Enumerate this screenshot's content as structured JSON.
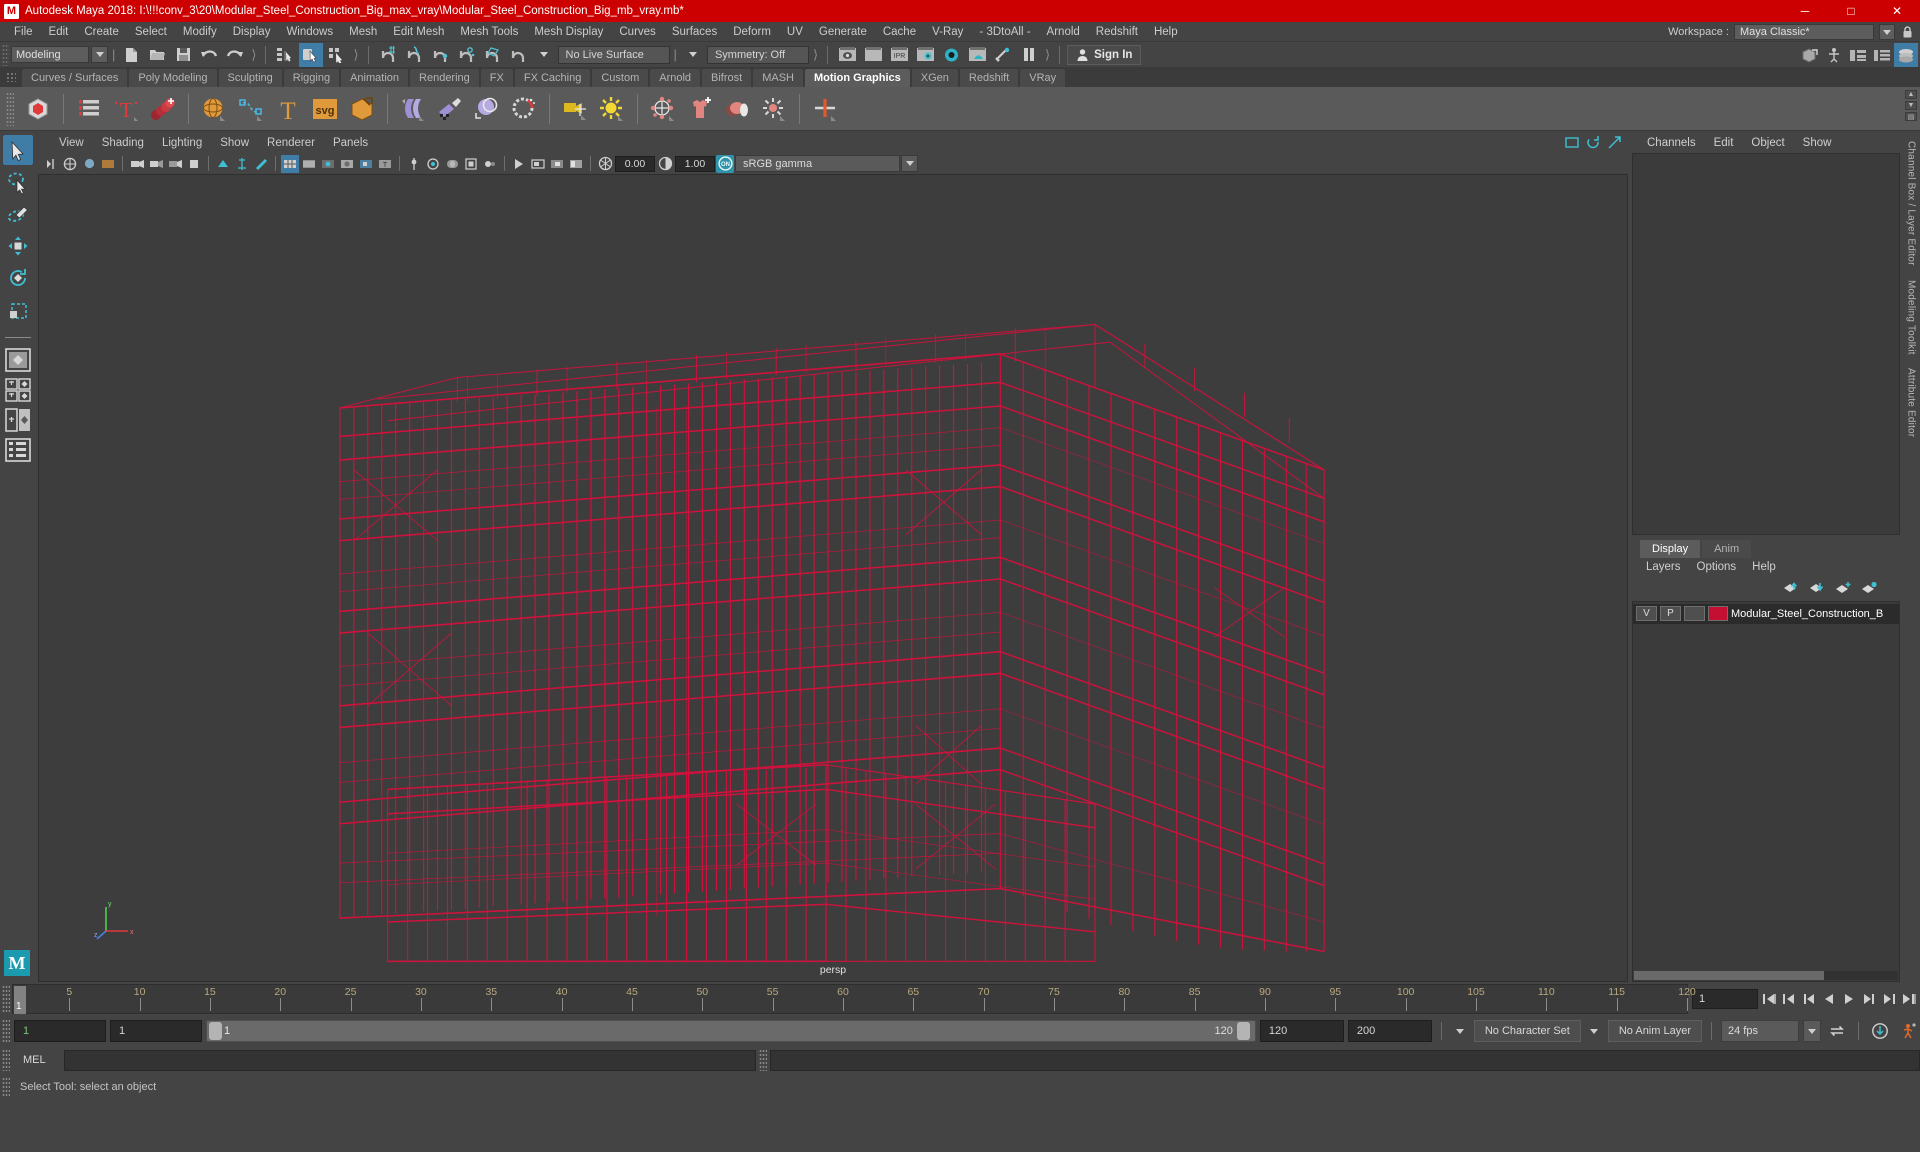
{
  "window": {
    "title": "Autodesk Maya 2018: I:\\!!!conv_3\\20\\Modular_Steel_Construction_Big_max_vray\\Modular_Steel_Construction_Big_mb_vray.mb*",
    "app_initial": "M",
    "titlebar_color": "#cc0000",
    "controls": {
      "minimize": "─",
      "maximize": "□",
      "close": "✕"
    }
  },
  "menubar": {
    "items": [
      "File",
      "Edit",
      "Create",
      "Select",
      "Modify",
      "Display",
      "Windows",
      "Mesh",
      "Edit Mesh",
      "Mesh Tools",
      "Mesh Display",
      "Curves",
      "Surfaces",
      "Deform",
      "UV",
      "Generate",
      "Cache",
      "V-Ray",
      "- 3DtoAll -",
      "Arnold",
      "Redshift",
      "Help"
    ],
    "workspace_label": "Workspace :",
    "workspace_value": "Maya Classic*"
  },
  "statusline": {
    "mode_menu": "Modeling",
    "live_surface": "No Live Surface",
    "symmetry": "Symmetry: Off",
    "signin": "Sign In",
    "icons": [
      "new-scene-icon",
      "open-scene-icon",
      "save-scene-icon",
      "undo-icon",
      "redo-icon",
      "select-hierarchy-icon",
      "select-object-icon",
      "select-component-icon",
      "snap-grid-icon",
      "snap-curve-icon",
      "snap-point-icon",
      "snap-projected-center-icon",
      "snap-view-plane-icon",
      "make-live-icon",
      "render-current-frame-icon",
      "ipr-render-icon",
      "render-settings-icon",
      "hypershade-icon",
      "render-view-icon",
      "light-toggle-icon",
      "pause-icon"
    ]
  },
  "shelf": {
    "tabs": [
      "Curves / Surfaces",
      "Poly Modeling",
      "Sculpting",
      "Rigging",
      "Animation",
      "Rendering",
      "FX",
      "FX Caching",
      "Custom",
      "Arnold",
      "Bifrost",
      "MASH",
      "Motion Graphics",
      "XGen",
      "Redshift",
      "VRay"
    ],
    "active_tab": "Motion Graphics",
    "icons": [
      "mash-network-icon",
      "mash-outliner-icon",
      "mash-trails-icon",
      "mash-dynamics-icon",
      "mash-sphere-icon",
      "mash-curve-icon",
      "mash-type-icon",
      "mash-svg-icon",
      "mash-3d-type-icon",
      "mash-deform-icon",
      "mash-paint-icon",
      "mash-cache-icon",
      "mash-orbit-icon",
      "mash-camera-icon",
      "mash-light-icon",
      "mash-radial-icon",
      "mash-cloth-icon",
      "mash-color-icon",
      "mash-explode-icon",
      "mash-merge-icon"
    ]
  },
  "toolbox": {
    "tools": [
      "select-tool",
      "lasso-select-tool",
      "paint-select-tool",
      "move-tool",
      "rotate-tool",
      "scale-tool"
    ],
    "layouts": [
      "single-perspective-view",
      "four-view-layout",
      "two-pane-layout",
      "outliner-persp-layout"
    ],
    "active": "select-tool",
    "logo": "M"
  },
  "viewport": {
    "menus": [
      "View",
      "Shading",
      "Lighting",
      "Show",
      "Renderer",
      "Panels"
    ],
    "camera_label": "persp",
    "exposure": "0.00",
    "gamma": "1.00",
    "color_space": "sRGB gamma",
    "gamma_toggle": "ON",
    "background_color": "#3d3d3d",
    "model_color": "#d6103c",
    "axis": {
      "x": "x",
      "y": "y",
      "z": "z"
    }
  },
  "channelbox": {
    "menus": [
      "Channels",
      "Edit",
      "Object",
      "Show"
    ],
    "empty": ""
  },
  "layers": {
    "tabs": [
      "Display",
      "Anim"
    ],
    "active_tab": "Display",
    "menus": [
      "Layers",
      "Options",
      "Help"
    ],
    "buttons": [
      "move-layer-up-icon",
      "move-layer-down-icon",
      "new-layer-icon",
      "new-layer-from-selected-icon"
    ],
    "rows": [
      {
        "visibility": "V",
        "playback": "P",
        "shading": "",
        "color": "#c40f32",
        "name": "Modular_Steel_Construction_B"
      }
    ]
  },
  "vertical_tabs": [
    "Channel Box / Layer Editor",
    "Modeling Toolkit",
    "Attribute Editor"
  ],
  "timeslider": {
    "current_frame": "1",
    "ticks": [
      5,
      10,
      15,
      20,
      25,
      30,
      35,
      40,
      45,
      50,
      55,
      60,
      65,
      70,
      75,
      80,
      85,
      90,
      95,
      100,
      105,
      110,
      115,
      120
    ],
    "range_start": 1,
    "range_end": 120,
    "frame_field": "1",
    "playback_buttons": [
      "go-to-start-icon",
      "step-back-keyframe-icon",
      "step-back-frame-icon",
      "play-backwards-icon",
      "play-forwards-icon",
      "step-forward-frame-icon",
      "step-forward-keyframe-icon",
      "go-to-end-icon"
    ]
  },
  "rangeslider": {
    "anim_start": "1",
    "range_start": "1",
    "slider_start_label": "1",
    "slider_end_label": "120",
    "range_end": "120",
    "anim_end": "200",
    "character_set": "No Character Set",
    "anim_layer": "No Anim Layer",
    "fps": "24 fps",
    "icons": [
      "auto-key-icon",
      "animation-preferences-icon",
      "playback-loop-icon"
    ]
  },
  "commandline": {
    "label": "MEL",
    "input_value": "",
    "output_value": ""
  },
  "statusbar": {
    "help_text": "Select Tool: select an object"
  }
}
